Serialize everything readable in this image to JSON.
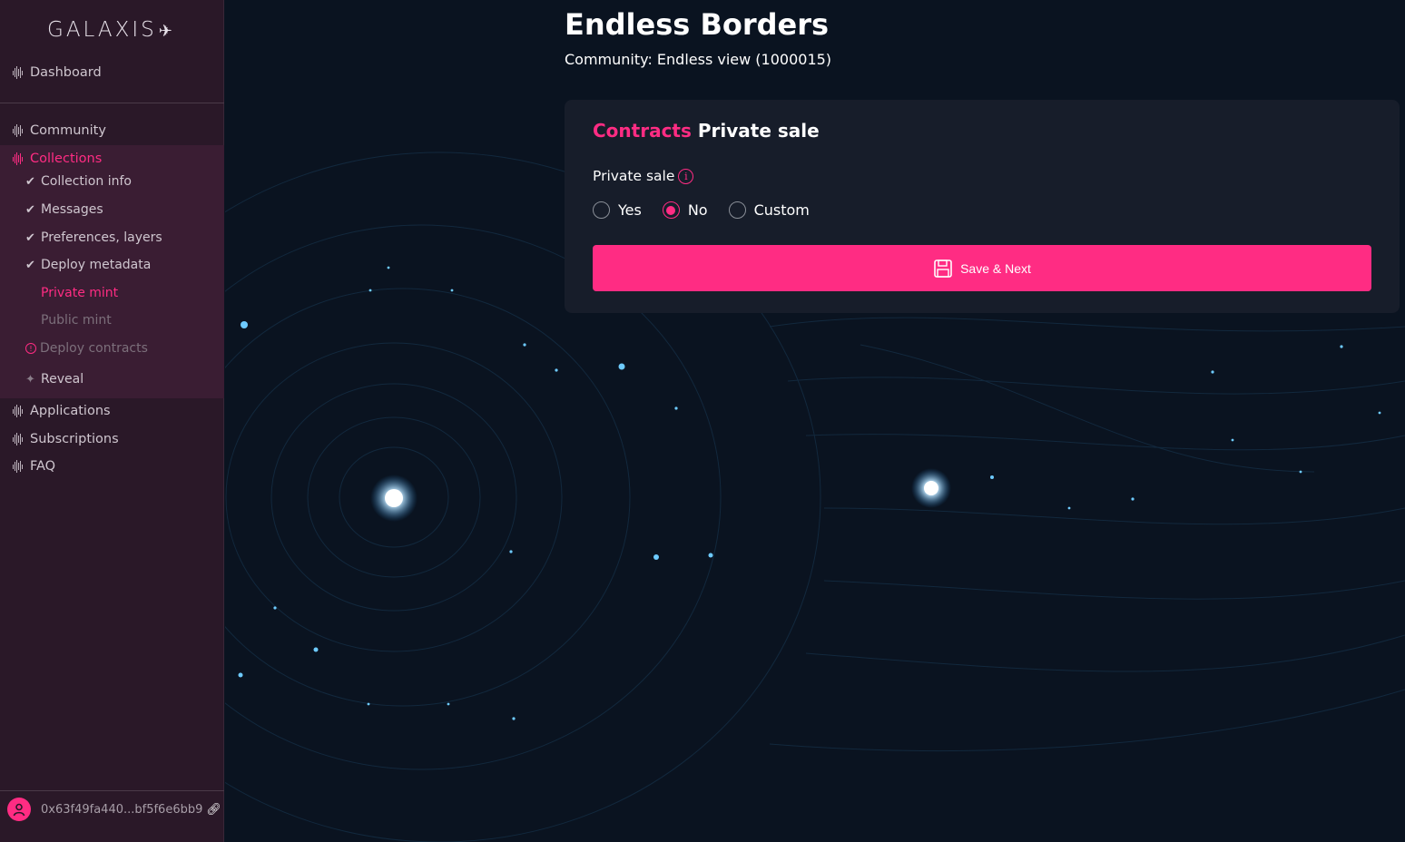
{
  "sidebar": {
    "logo": "GALAXIS",
    "items": [
      {
        "label": "Dashboard"
      },
      {
        "label": "Community"
      },
      {
        "label": "Collections"
      },
      {
        "label": "Applications"
      },
      {
        "label": "Subscriptions"
      },
      {
        "label": "FAQ"
      }
    ],
    "collection_steps": [
      {
        "label": "Collection info",
        "status": "done"
      },
      {
        "label": "Messages",
        "status": "done"
      },
      {
        "label": "Preferences, layers",
        "status": "done"
      },
      {
        "label": "Deploy metadata",
        "status": "done"
      },
      {
        "label": "Private mint",
        "status": "active"
      },
      {
        "label": "Public mint",
        "status": "pending"
      },
      {
        "label": "Deploy contracts",
        "status": "warning"
      },
      {
        "label": "Reveal",
        "status": "locked"
      }
    ],
    "wallet": "0x63f49fa440...bf5f6e6bb9"
  },
  "header": {
    "title": "Endless Borders",
    "subtitle": "Community: Endless view (1000015)"
  },
  "card": {
    "title_accent": "Contracts",
    "title_rest": "Private sale",
    "field_label": "Private sale",
    "options": [
      {
        "label": "Yes",
        "checked": false
      },
      {
        "label": "No",
        "checked": true
      },
      {
        "label": "Custom",
        "checked": false
      }
    ],
    "save_label": "Save & Next"
  },
  "colors": {
    "accent": "#ff2c83",
    "sidebar_bg": "#2a1828",
    "card_bg": "#171d2a",
    "page_bg": "#0b1420"
  }
}
